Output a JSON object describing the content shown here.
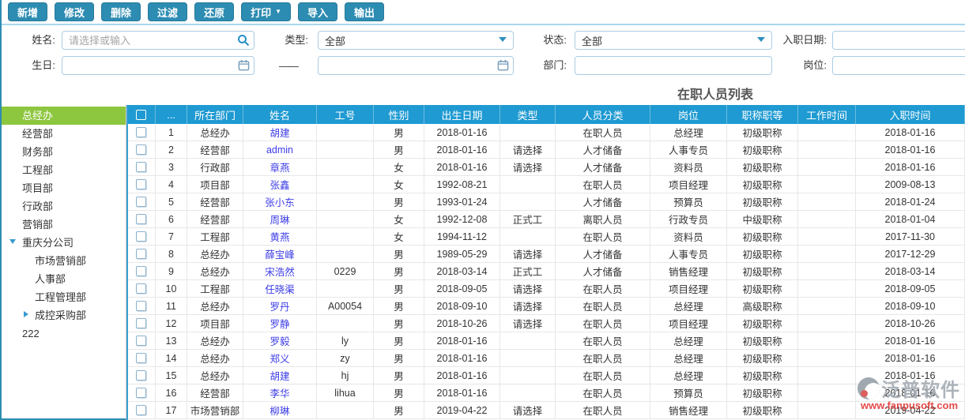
{
  "colors": {
    "accent": "#2d8cb2",
    "header-blue": "#1f9ad2",
    "selected-green": "#8dc63f",
    "link-blue": "#3d3de8"
  },
  "toolbar": {
    "buttons": [
      {
        "name": "add",
        "label": "新增",
        "caret": false
      },
      {
        "name": "edit",
        "label": "修改",
        "caret": false
      },
      {
        "name": "delete",
        "label": "删除",
        "caret": false
      },
      {
        "name": "filter",
        "label": "过滤",
        "caret": false
      },
      {
        "name": "restore",
        "label": "还原",
        "caret": false
      },
      {
        "name": "print",
        "label": "打印",
        "caret": true
      },
      {
        "name": "import",
        "label": "导入",
        "caret": false
      },
      {
        "name": "export",
        "label": "输出",
        "caret": false
      }
    ]
  },
  "filters": {
    "name": {
      "label": "姓名:",
      "placeholder": "请选择或输入",
      "value": ""
    },
    "type": {
      "label": "类型:",
      "value": "全部"
    },
    "status": {
      "label": "状态:",
      "value": "全部"
    },
    "hire_date": {
      "label": "入职日期:",
      "value": ""
    },
    "birthday": {
      "label": "生日:",
      "value_from": "",
      "value_to": "",
      "separator": "——"
    },
    "department": {
      "label": "部门:",
      "value": ""
    },
    "post": {
      "label": "岗位:",
      "value": ""
    }
  },
  "sidebar": {
    "items": [
      {
        "label": "总经办",
        "level": 0,
        "selected": true,
        "expander": ""
      },
      {
        "label": "经营部",
        "level": 0,
        "selected": false,
        "expander": ""
      },
      {
        "label": "财务部",
        "level": 0,
        "selected": false,
        "expander": ""
      },
      {
        "label": "工程部",
        "level": 0,
        "selected": false,
        "expander": ""
      },
      {
        "label": "项目部",
        "level": 0,
        "selected": false,
        "expander": ""
      },
      {
        "label": "行政部",
        "level": 0,
        "selected": false,
        "expander": ""
      },
      {
        "label": "营销部",
        "level": 0,
        "selected": false,
        "expander": ""
      },
      {
        "label": "重庆分公司",
        "level": 0,
        "selected": false,
        "expander": "down"
      },
      {
        "label": "市场营销部",
        "level": 1,
        "selected": false,
        "expander": ""
      },
      {
        "label": "人事部",
        "level": 1,
        "selected": false,
        "expander": ""
      },
      {
        "label": "工程管理部",
        "level": 1,
        "selected": false,
        "expander": ""
      },
      {
        "label": "成控采购部",
        "level": 1,
        "selected": false,
        "expander": "right"
      },
      {
        "label": "222",
        "level": 0,
        "selected": false,
        "expander": ""
      }
    ]
  },
  "table": {
    "title": "在职人员列表",
    "columns": [
      "",
      "...",
      "所在部门",
      "姓名",
      "工号",
      "性别",
      "出生日期",
      "类型",
      "人员分类",
      "岗位",
      "职称职等",
      "工作时间",
      "入职时间"
    ],
    "rows": [
      [
        "1",
        "总经办",
        "胡建",
        "",
        "男",
        "2018-01-16",
        "",
        "在职人员",
        "总经理",
        "初级职称",
        "",
        "2018-01-16"
      ],
      [
        "2",
        "经营部",
        "admin",
        "",
        "男",
        "2018-01-16",
        "请选择",
        "人才储备",
        "人事专员",
        "初级职称",
        "",
        "2018-01-16"
      ],
      [
        "3",
        "行政部",
        "章燕",
        "",
        "女",
        "2018-01-16",
        "请选择",
        "人才储备",
        "资料员",
        "初级职称",
        "",
        "2018-01-16"
      ],
      [
        "4",
        "项目部",
        "张鑫",
        "",
        "女",
        "1992-08-21",
        "",
        "在职人员",
        "项目经理",
        "初级职称",
        "",
        "2009-08-13"
      ],
      [
        "5",
        "经营部",
        "张小东",
        "",
        "男",
        "1993-01-24",
        "",
        "人才储备",
        "预算员",
        "初级职称",
        "",
        "2018-01-24"
      ],
      [
        "6",
        "经营部",
        "周琳",
        "",
        "女",
        "1992-12-08",
        "正式工",
        "离职人员",
        "行政专员",
        "中级职称",
        "",
        "2018-01-04"
      ],
      [
        "7",
        "工程部",
        "黄燕",
        "",
        "女",
        "1994-11-12",
        "",
        "在职人员",
        "资料员",
        "初级职称",
        "",
        "2017-11-30"
      ],
      [
        "8",
        "总经办",
        "薛宝峰",
        "",
        "男",
        "1989-05-29",
        "请选择",
        "人才储备",
        "人事专员",
        "初级职称",
        "",
        "2017-12-29"
      ],
      [
        "9",
        "总经办",
        "宋浩然",
        "0229",
        "男",
        "2018-03-14",
        "正式工",
        "人才储备",
        "销售经理",
        "初级职称",
        "",
        "2018-03-14"
      ],
      [
        "10",
        "工程部",
        "任晓渠",
        "",
        "男",
        "2018-09-05",
        "请选择",
        "在职人员",
        "项目经理",
        "初级职称",
        "",
        "2018-09-05"
      ],
      [
        "11",
        "总经办",
        "罗丹",
        "A00054",
        "男",
        "2018-09-10",
        "请选择",
        "在职人员",
        "总经理",
        "高级职称",
        "",
        "2018-09-10"
      ],
      [
        "12",
        "项目部",
        "罗静",
        "",
        "男",
        "2018-10-26",
        "请选择",
        "在职人员",
        "项目经理",
        "初级职称",
        "",
        "2018-10-26"
      ],
      [
        "13",
        "总经办",
        "罗毅",
        "ly",
        "男",
        "2018-01-16",
        "",
        "在职人员",
        "总经理",
        "初级职称",
        "",
        "2018-01-16"
      ],
      [
        "14",
        "总经办",
        "郑义",
        "zy",
        "男",
        "2018-01-16",
        "",
        "在职人员",
        "总经理",
        "初级职称",
        "",
        "2018-01-16"
      ],
      [
        "15",
        "总经办",
        "胡建",
        "hj",
        "男",
        "2018-01-16",
        "",
        "在职人员",
        "总经理",
        "初级职称",
        "",
        "2018-01-16"
      ],
      [
        "16",
        "经营部",
        "李华",
        "lihua",
        "男",
        "2018-01-16",
        "",
        "在职人员",
        "预算员",
        "初级职称",
        "",
        "2018-01-16"
      ],
      [
        "17",
        "市场营销部",
        "柳琳",
        "",
        "男",
        "2019-04-22",
        "请选择",
        "在职人员",
        "销售经理",
        "初级职称",
        "",
        "2019-04-22"
      ]
    ]
  },
  "watermark": {
    "brand": "泛普软件",
    "url": "www.fanpusoft.com"
  }
}
